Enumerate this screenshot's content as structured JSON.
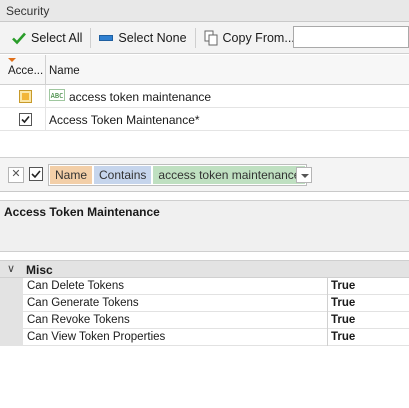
{
  "panel": {
    "title": "Security"
  },
  "toolbar": {
    "select_all": "Select All",
    "select_none": "Select None",
    "copy_from": "Copy From...",
    "search_value": ""
  },
  "grid": {
    "columns": [
      "Acce...",
      "Name"
    ],
    "filter_row_text": "access token maintenance",
    "rows": [
      {
        "name": "Access Token Maintenance*",
        "checked": true
      }
    ]
  },
  "filter": {
    "field": "Name",
    "operator": "Contains",
    "value": "access token maintenance"
  },
  "description": {
    "title": "Access Token Maintenance"
  },
  "properties": {
    "category": "Misc",
    "items": [
      {
        "name": "Can Delete Tokens",
        "value": "True"
      },
      {
        "name": "Can Generate Tokens",
        "value": "True"
      },
      {
        "name": "Can Revoke Tokens",
        "value": "True"
      },
      {
        "name": "Can View Token Properties",
        "value": "True"
      }
    ]
  },
  "colors": {
    "accent_check": "#2a9d2a",
    "field_chip": "#f3cfa8",
    "operator_chip": "#c6d5ec",
    "value_chip": "#bfe0c1"
  }
}
